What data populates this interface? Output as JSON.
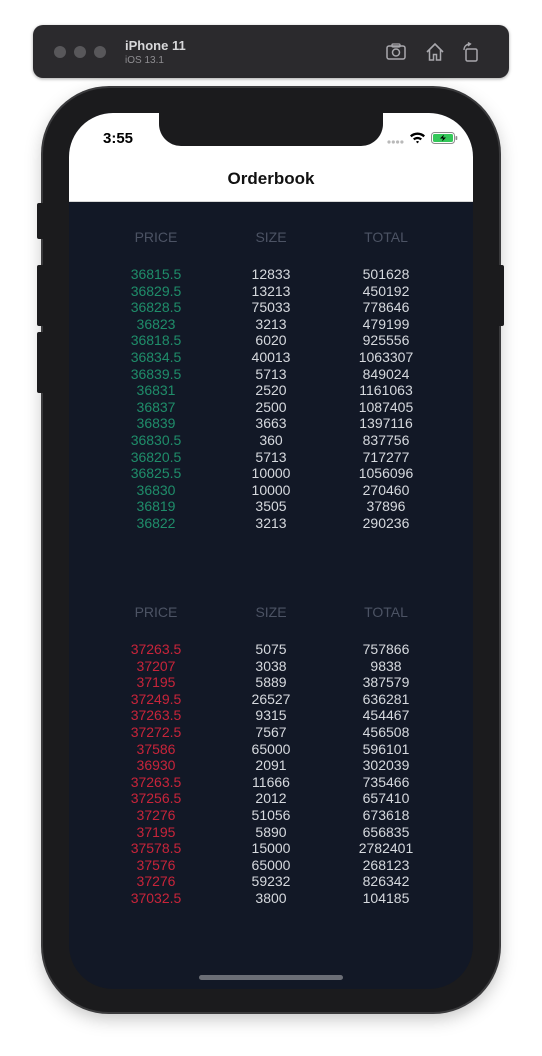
{
  "simulator": {
    "device_name": "iPhone 11",
    "os_version": "iOS 13.1",
    "icons": [
      "screenshot-icon",
      "home-icon",
      "rotate-icon"
    ]
  },
  "status_bar": {
    "time": "3:55",
    "icons": [
      "signal-icon",
      "wifi-icon",
      "battery-charging-icon"
    ]
  },
  "nav": {
    "title": "Orderbook"
  },
  "colors": {
    "background": "#121826",
    "bid_price": "#1f8d6a",
    "ask_price": "#c8243a",
    "header_text": "#4c5364",
    "value_text": "#d6d9de"
  },
  "bids": {
    "headers": {
      "price": "PRICE",
      "size": "SIZE",
      "total": "TOTAL"
    },
    "rows": [
      {
        "price": "36815.5",
        "size": "12833",
        "total": "501628"
      },
      {
        "price": "36829.5",
        "size": "13213",
        "total": "450192"
      },
      {
        "price": "36828.5",
        "size": "75033",
        "total": "778646"
      },
      {
        "price": "36823",
        "size": "3213",
        "total": "479199"
      },
      {
        "price": "36818.5",
        "size": "6020",
        "total": "925556"
      },
      {
        "price": "36834.5",
        "size": "40013",
        "total": "1063307"
      },
      {
        "price": "36839.5",
        "size": "5713",
        "total": "849024"
      },
      {
        "price": "36831",
        "size": "2520",
        "total": "1161063"
      },
      {
        "price": "36837",
        "size": "2500",
        "total": "1087405"
      },
      {
        "price": "36839",
        "size": "3663",
        "total": "1397116"
      },
      {
        "price": "36830.5",
        "size": "360",
        "total": "837756"
      },
      {
        "price": "36820.5",
        "size": "5713",
        "total": "717277"
      },
      {
        "price": "36825.5",
        "size": "10000",
        "total": "1056096"
      },
      {
        "price": "36830",
        "size": "10000",
        "total": "270460"
      },
      {
        "price": "36819",
        "size": "3505",
        "total": "37896"
      },
      {
        "price": "36822",
        "size": "3213",
        "total": "290236"
      }
    ]
  },
  "asks": {
    "headers": {
      "price": "PRICE",
      "size": "SIZE",
      "total": "TOTAL"
    },
    "rows": [
      {
        "price": "37263.5",
        "size": "5075",
        "total": "757866"
      },
      {
        "price": "37207",
        "size": "3038",
        "total": "9838"
      },
      {
        "price": "37195",
        "size": "5889",
        "total": "387579"
      },
      {
        "price": "37249.5",
        "size": "26527",
        "total": "636281"
      },
      {
        "price": "37263.5",
        "size": "9315",
        "total": "454467"
      },
      {
        "price": "37272.5",
        "size": "7567",
        "total": "456508"
      },
      {
        "price": "37586",
        "size": "65000",
        "total": "596101"
      },
      {
        "price": "36930",
        "size": "2091",
        "total": "302039"
      },
      {
        "price": "37263.5",
        "size": "11666",
        "total": "735466"
      },
      {
        "price": "37256.5",
        "size": "2012",
        "total": "657410"
      },
      {
        "price": "37276",
        "size": "51056",
        "total": "673618"
      },
      {
        "price": "37195",
        "size": "5890",
        "total": "656835"
      },
      {
        "price": "37578.5",
        "size": "15000",
        "total": "2782401"
      },
      {
        "price": "37576",
        "size": "65000",
        "total": "268123"
      },
      {
        "price": "37276",
        "size": "59232",
        "total": "826342"
      },
      {
        "price": "37032.5",
        "size": "3800",
        "total": "104185"
      }
    ]
  }
}
